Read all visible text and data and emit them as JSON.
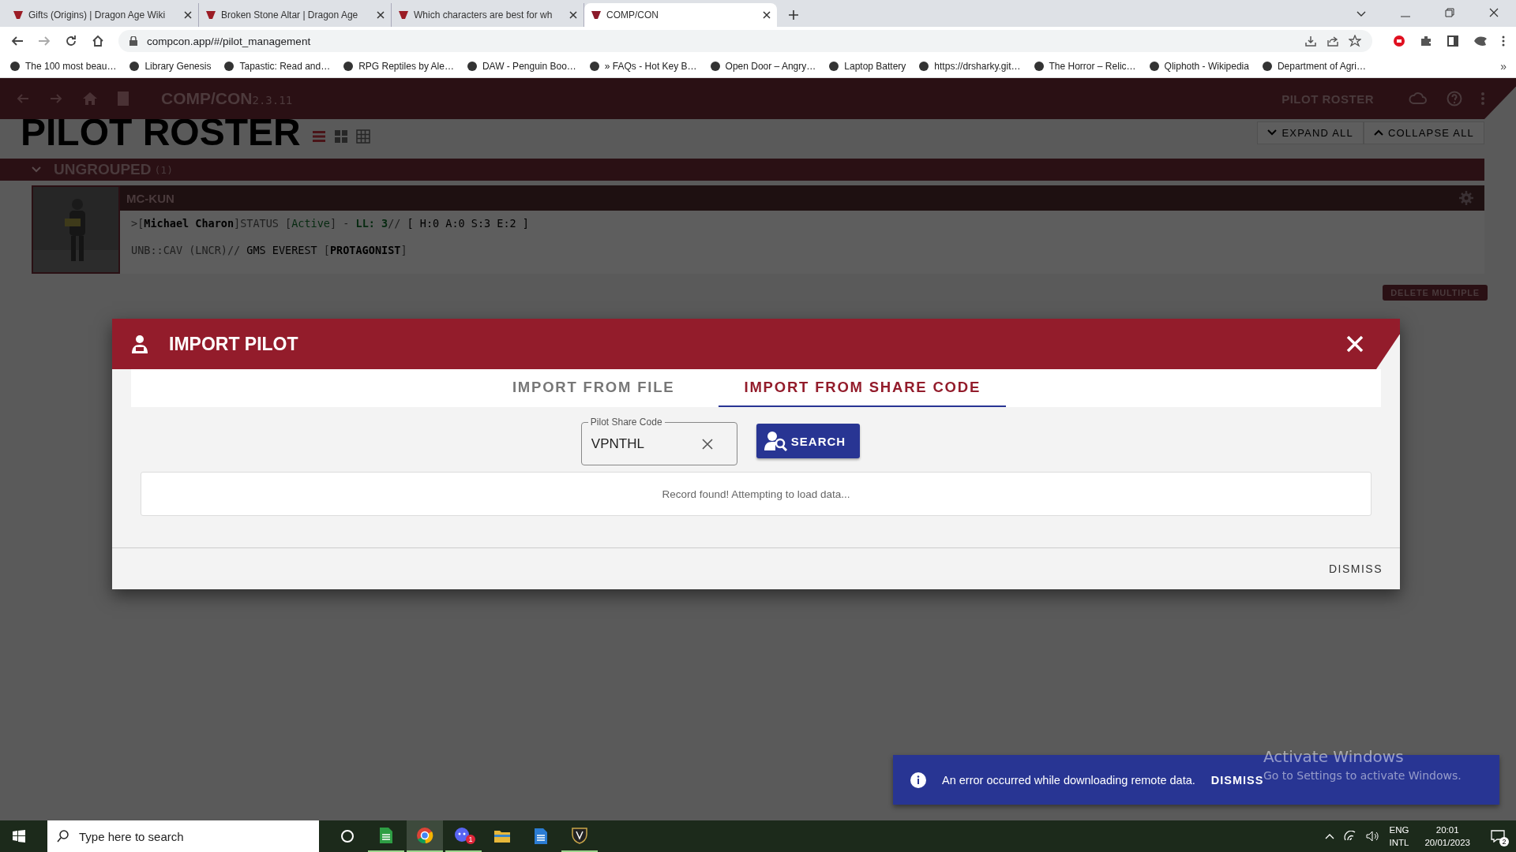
{
  "browser": {
    "tabs": [
      {
        "title": "Gifts (Origins) | Dragon Age Wiki",
        "selected": false
      },
      {
        "title": "Broken Stone Altar | Dragon Age",
        "selected": false
      },
      {
        "title": "Which characters are best for wh",
        "selected": false
      },
      {
        "title": "COMP/CON",
        "selected": true
      }
    ],
    "url": "compcon.app/#/pilot_management",
    "bookmarks": [
      "The 100 most beau…",
      "Library Genesis",
      "Tapastic: Read and…",
      "RPG Reptiles by Ale…",
      "DAW - Penguin Boo…",
      "» FAQs - Hot Key B…",
      "Open Door – Angry…",
      "Laptop Battery",
      "https://drsharky.git…",
      "The Horror – Relic…",
      "Qliphoth - Wikipedia",
      "Department of Agri…"
    ],
    "bookmarks_overflow": "»"
  },
  "app": {
    "title": "COMP/CON",
    "version": "2.3.11",
    "nav_label": "PILOT ROSTER",
    "page_title": "PILOT ROSTER",
    "view_modes": [
      {
        "kind": "list",
        "selected": true
      },
      {
        "kind": "cards",
        "selected": false
      },
      {
        "kind": "grid",
        "selected": false
      }
    ],
    "expand_all": "EXPAND ALL",
    "collapse_all": "COLLAPSE ALL",
    "group": {
      "name": "UNGROUPED",
      "count": "(1)",
      "expanded": true
    },
    "pilot": {
      "callsign": "MC-KUN",
      "line_1": [
        {
          "text": ">[",
          "kind": "dim"
        },
        {
          "text": "Michael Charon",
          "kind": "bold"
        },
        {
          "text": "]STATUS [",
          "kind": "dim"
        },
        {
          "text": "Active",
          "kind": "green"
        },
        {
          "text": "] - ",
          "kind": "dim"
        },
        {
          "text": "LL: 3",
          "kind": "greenbold"
        },
        {
          "text": "//",
          "kind": "dim"
        },
        {
          "text": " [ H:0 A:0 S:3 E:2 ]",
          "kind": "plain"
        }
      ],
      "line_2": [
        {
          "text": "UNB::CAV (LNCR)//",
          "kind": "dim"
        },
        {
          "text": " GMS EVEREST ",
          "kind": "plain"
        },
        {
          "text": "[",
          "kind": "dim"
        },
        {
          "text": "PROTAGONIST",
          "kind": "bold"
        },
        {
          "text": "]",
          "kind": "dim"
        }
      ]
    },
    "delete_multiple": "DELETE MULTIPLE"
  },
  "dialog": {
    "title": "IMPORT PILOT",
    "tabs": [
      {
        "label": "IMPORT FROM FILE",
        "selected": false
      },
      {
        "label": "IMPORT FROM SHARE CODE",
        "selected": true
      }
    ],
    "share_code": {
      "label": "Pilot Share Code",
      "value": "VPNTHL"
    },
    "search_button": "SEARCH",
    "result": "Record found! Attempting to load data...",
    "footer_button": "DISMISS"
  },
  "snackbar": {
    "message": "An error occurred while downloading remote data.",
    "action": "DISMISS"
  },
  "activation_notice": {
    "title": "Activate Windows",
    "subtitle": "Go to Settings to activate Windows."
  },
  "taskbar": {
    "search_placeholder": "Type here to search",
    "apps": [
      {
        "kind": "task-view",
        "selected": false,
        "running": false
      },
      {
        "kind": "sheets",
        "selected": false,
        "running": true
      },
      {
        "kind": "browser",
        "selected": true,
        "running": true
      },
      {
        "kind": "chat",
        "selected": false,
        "running": true,
        "badge": "1"
      },
      {
        "kind": "folder",
        "selected": false,
        "running": false
      },
      {
        "kind": "document",
        "selected": false,
        "running": false
      },
      {
        "kind": "game",
        "selected": false,
        "running": true
      }
    ],
    "language": "ENG",
    "layout": "INTL",
    "time": "20:01",
    "date": "20/01/2023",
    "notifications": "2"
  }
}
